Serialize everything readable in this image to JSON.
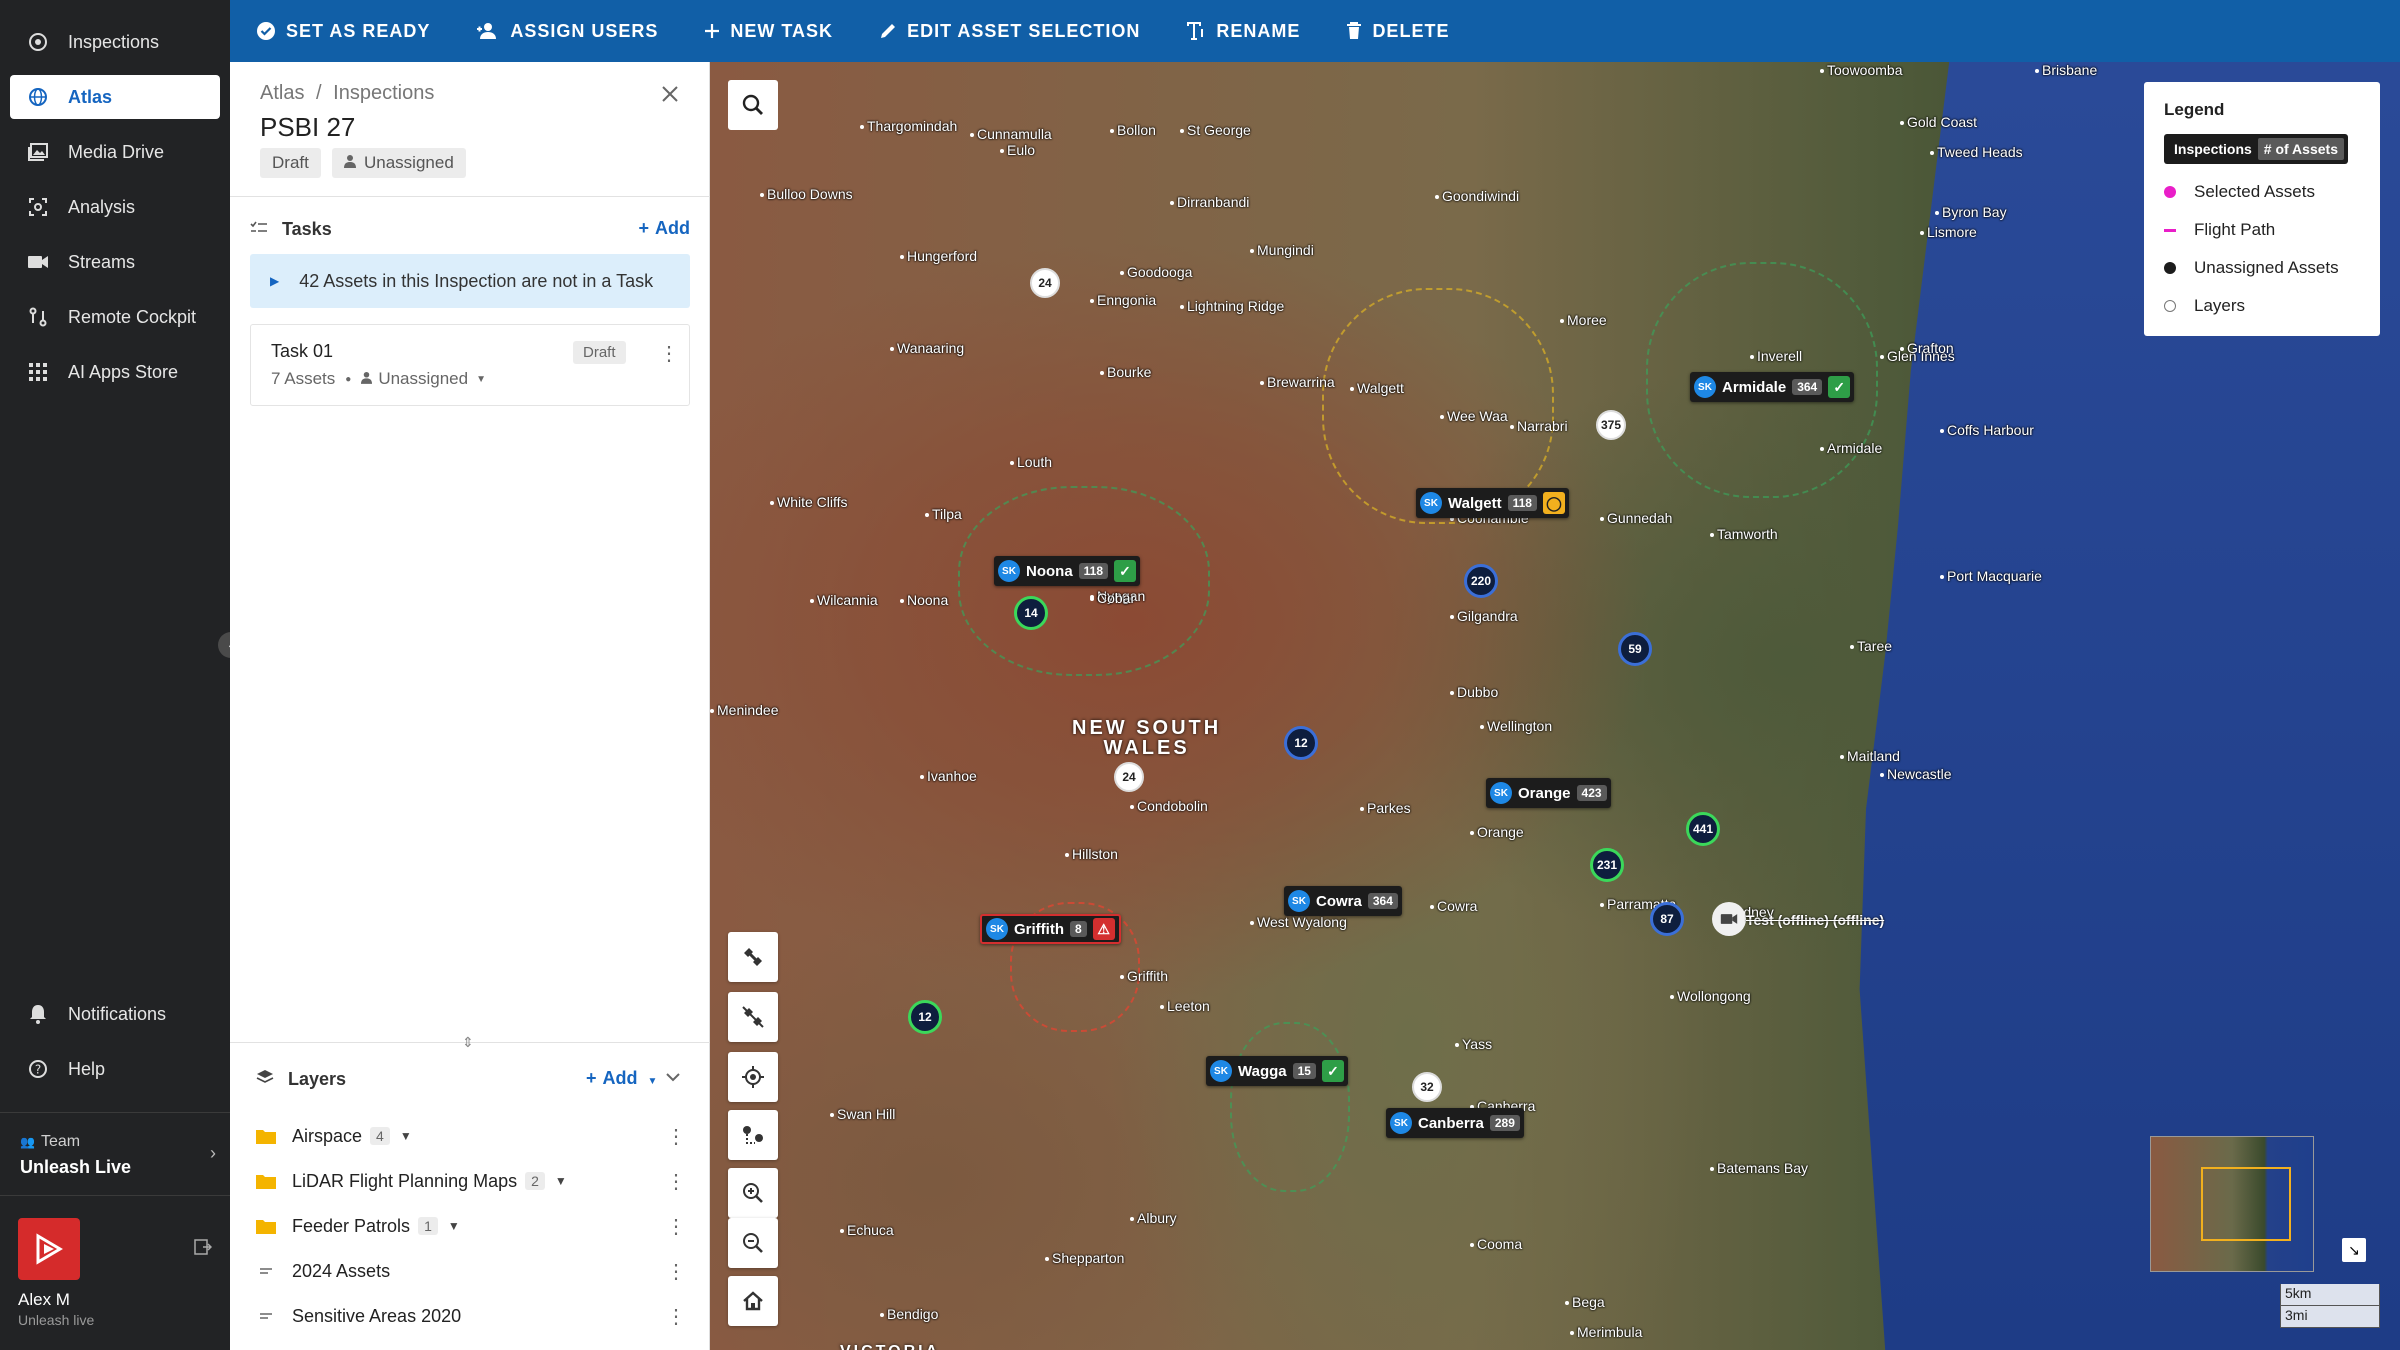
{
  "nav": {
    "items": [
      {
        "label": "Inspections",
        "icon": "target-icon"
      },
      {
        "label": "Atlas",
        "icon": "globe-icon"
      },
      {
        "label": "Media Drive",
        "icon": "photo-library-icon"
      },
      {
        "label": "Analysis",
        "icon": "scan-icon"
      },
      {
        "label": "Streams",
        "icon": "video-camera-icon"
      },
      {
        "label": "Remote Cockpit",
        "icon": "route-icon"
      },
      {
        "label": "AI Apps Store",
        "icon": "grid-icon"
      }
    ],
    "bottom": [
      {
        "label": "Notifications",
        "icon": "bell-icon"
      },
      {
        "label": "Help",
        "icon": "help-circle-icon"
      }
    ],
    "team_label": "Team",
    "team_name": "Unleash Live",
    "user_name": "Alex M",
    "user_org": "Unleash live"
  },
  "toolbar": {
    "set_ready": "SET AS READY",
    "assign_users": "ASSIGN USERS",
    "new_task": "NEW TASK",
    "edit_asset": "EDIT ASSET SELECTION",
    "rename": "RENAME",
    "delete": "DELETE"
  },
  "panel": {
    "crumb1": "Atlas",
    "crumb_sep": "/",
    "crumb2": "Inspections",
    "title": "PSBI 27",
    "status": "Draft",
    "assignee": "Unassigned",
    "tasks_header": "Tasks",
    "tasks_add": "Add",
    "notice": "42 Assets in this Inspection are not in a Task",
    "task": {
      "name": "Task 01",
      "assets": "7 Assets",
      "assignee": "Unassigned",
      "status": "Draft"
    },
    "layers_header": "Layers",
    "layers_add": "Add",
    "layers": [
      {
        "name": "Airspace",
        "count": "4",
        "type": "folder"
      },
      {
        "name": "LiDAR Flight Planning Maps",
        "count": "2",
        "type": "folder"
      },
      {
        "name": "Feeder Patrols",
        "count": "1",
        "type": "folder"
      },
      {
        "name": "2024 Assets",
        "count": "",
        "type": "layer"
      },
      {
        "name": "Sensitive Areas 2020",
        "count": "",
        "type": "layer"
      }
    ]
  },
  "map": {
    "state_label_1": "NEW SOUTH",
    "state_label_2": "WALES",
    "state_label_3": "VICTORIA",
    "towns": [
      "Toowoomba",
      "Brisbane",
      "Gold Coast",
      "Tweed Heads",
      "Thargomindah",
      "Cunnamulla",
      "Bollon",
      "St George",
      "Eulo",
      "Dirranbandi",
      "Goondiwindi",
      "Byron Bay",
      "Lismore",
      "Bulloo Downs",
      "Mungindi",
      "Hungerford",
      "Goodooga",
      "Lightning Ridge",
      "Moree",
      "Enngonia",
      "Wanaaring",
      "Bourke",
      "Brewarrina",
      "Walgett",
      "Wee Waa",
      "Narrabri",
      "Inverell",
      "Glen Innes",
      "Grafton",
      "Armidale",
      "Coffs Harbour",
      "Louth",
      "White Cliffs",
      "Tilpa",
      "Coonamble",
      "Gunnedah",
      "Tamworth",
      "Port Macquarie",
      "Wilcannia",
      "Nyngan",
      "Gilgandra",
      "Taree",
      "Menindee",
      "Dubbo",
      "Wellington",
      "Maitland",
      "Newcastle",
      "Ivanhoe",
      "Condobolin",
      "Parkes",
      "Orange",
      "Hillston",
      "Cowra",
      "West Wyalong",
      "Parramatta",
      "Sydney",
      "Griffith",
      "Leeton",
      "Wollongong",
      "Yass",
      "Canberra",
      "Swan Hill",
      "Batemans Bay",
      "Echuca",
      "Albury",
      "Shepparton",
      "Cooma",
      "Bendigo",
      "Bega",
      "Merimbula",
      "Cobar",
      "Noona"
    ],
    "markers": [
      {
        "label": "Armidale",
        "count": "364",
        "status": "ok"
      },
      {
        "label": "Walgett",
        "count": "118",
        "status": "warn"
      },
      {
        "label": "Noona",
        "count": "118",
        "status": "ok"
      },
      {
        "label": "Orange",
        "count": "423",
        "status": ""
      },
      {
        "label": "Cowra",
        "count": "364",
        "status": ""
      },
      {
        "label": "Griffith",
        "count": "8",
        "status": "err"
      },
      {
        "label": "Wagga",
        "count": "15",
        "status": "ok"
      },
      {
        "label": "Canberra",
        "count": "289",
        "status": ""
      }
    ],
    "marker_prefix": "SK",
    "clusters": [
      "24",
      "375",
      "220",
      "14",
      "59",
      "12",
      "24",
      "441",
      "231",
      "87",
      "12",
      "32"
    ],
    "camera_label": "Test (offline) (offline)",
    "scale_km": "5km",
    "scale_mi": "3mi"
  },
  "legend": {
    "title": "Legend",
    "tab1": "Inspections",
    "tab2": "# of Assets",
    "items": [
      {
        "label": "Selected Assets",
        "color": "#e91ec8"
      },
      {
        "label": "Flight Path",
        "color": "#e91ec8"
      },
      {
        "label": "Unassigned Assets",
        "color": "#1c1c1c"
      },
      {
        "label": "Layers",
        "color": "#ffffff"
      }
    ]
  }
}
